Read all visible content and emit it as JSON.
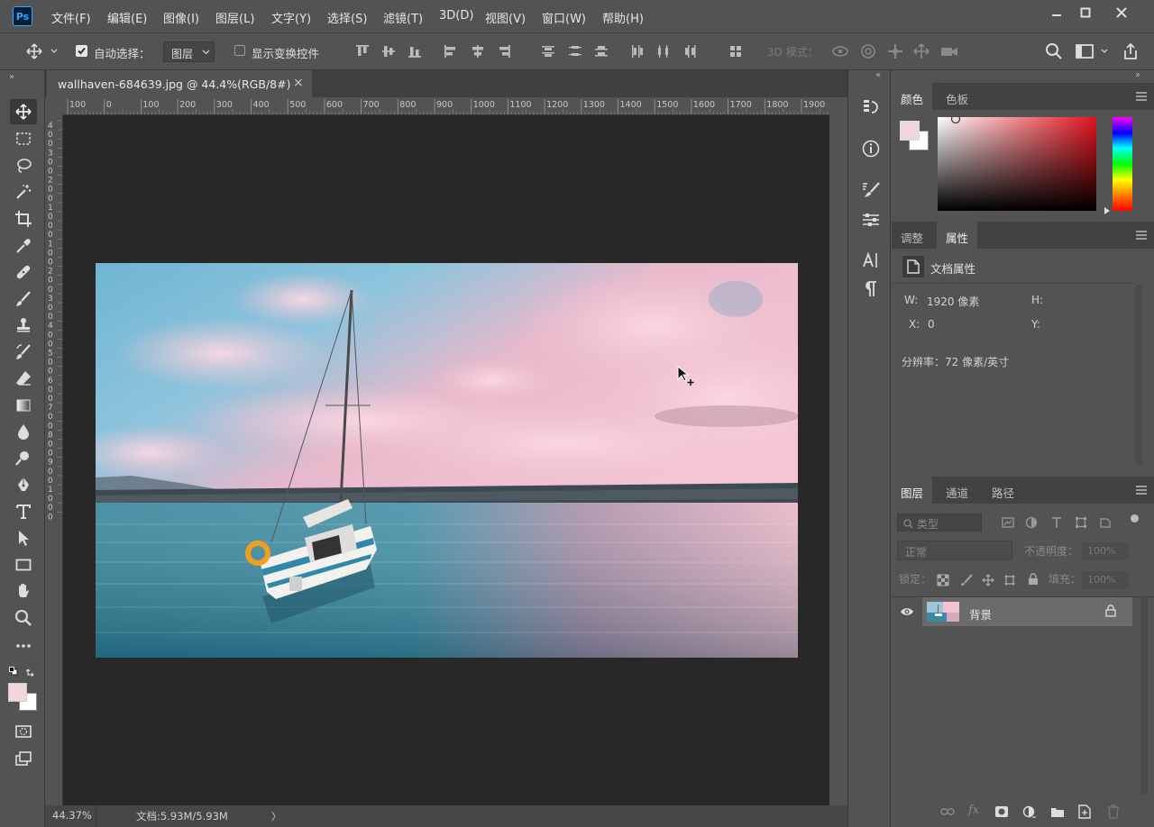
{
  "app": {
    "logo": "Ps"
  },
  "menu": [
    "文件(F)",
    "编辑(E)",
    "图像(I)",
    "图层(L)",
    "文字(Y)",
    "选择(S)",
    "滤镜(T)",
    "3D(D)",
    "视图(V)",
    "窗口(W)",
    "帮助(H)"
  ],
  "options": {
    "auto_select_label": "自动选择：",
    "auto_select_value": "图层",
    "show_transform_label": "显示变换控件",
    "mode3d_label": "3D 模式："
  },
  "document": {
    "tab_title": "wallhaven-684639.jpg @ 44.4%(RGB/8#)",
    "close": "×"
  },
  "ruler": {
    "h_ticks": [
      "100",
      "0",
      "100",
      "200",
      "300",
      "400",
      "500",
      "600",
      "700",
      "800",
      "900",
      "1000",
      "1100",
      "1200",
      "1300",
      "1400",
      "1500",
      "1600",
      "1700",
      "1800",
      "1900"
    ],
    "v_ticks": [
      "4",
      "0",
      "0",
      "3",
      "0",
      "0",
      "2",
      "0",
      "0",
      "1",
      "0",
      "0",
      "0",
      "1",
      "0",
      "0",
      "2",
      "0",
      "0",
      "3",
      "0",
      "0",
      "4",
      "0",
      "0",
      "5",
      "0",
      "0",
      "6",
      "0",
      "0",
      "7",
      "0",
      "0",
      "8",
      "0",
      "0",
      "9",
      "0",
      "0",
      "1",
      "0",
      "0",
      "0"
    ]
  },
  "status": {
    "zoom": "44.37%",
    "doc": "文档:5.93M/5.93M",
    "arrow": "〉"
  },
  "color_panel": {
    "tabs": [
      "颜色",
      "色板"
    ],
    "foreground": "#f1d7da",
    "background": "#ffffff"
  },
  "properties_panel": {
    "tabs": [
      "调整",
      "属性"
    ],
    "section": "文档属性",
    "w_label": "W:",
    "w_value": "1920 像素",
    "h_label": "H:",
    "x_label": "X:",
    "x_value": "0",
    "y_label": "Y:",
    "resolution": "分辨率：72 像素/英寸"
  },
  "layers_panel": {
    "tabs": [
      "图层",
      "通道",
      "路径"
    ],
    "filter_placeholder": "类型",
    "blend_mode": "正常",
    "opacity_label": "不透明度：",
    "opacity_value": "100%",
    "lock_label": "锁定：",
    "fill_label": "填充：",
    "fill_value": "100%",
    "layers": [
      {
        "name": "背景",
        "visible": true,
        "locked": true
      }
    ]
  },
  "colors": {
    "accent": "#31a8ff",
    "bg_ui": "#535353",
    "canvas": "#282828"
  }
}
